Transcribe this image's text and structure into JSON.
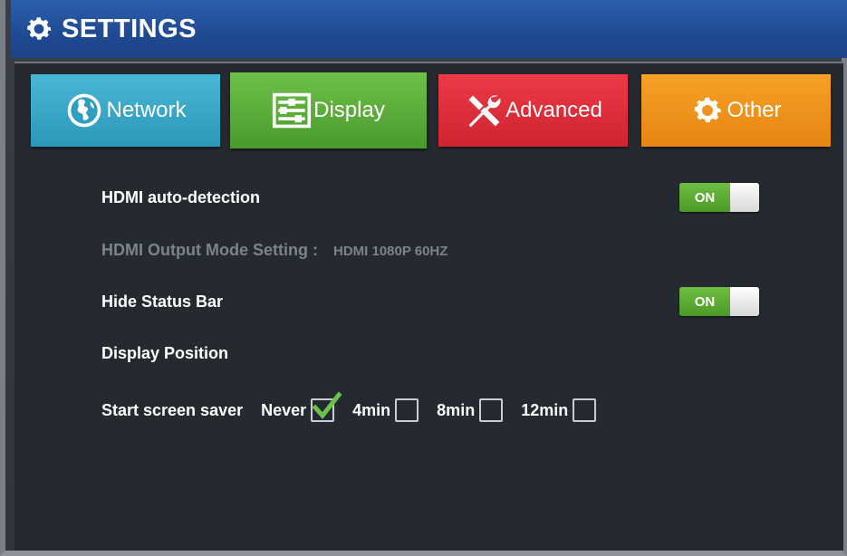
{
  "window": {
    "title": "SETTINGS",
    "title_icon": "gear-icon"
  },
  "tabs": [
    {
      "label": "Network",
      "icon": "globe-icon",
      "color": "#3aa7c8"
    },
    {
      "label": "Display",
      "icon": "sliders-icon",
      "color": "#5cad39",
      "selected": true
    },
    {
      "label": "Advanced",
      "icon": "tools-icon",
      "color": "#de2f3a"
    },
    {
      "label": "Other",
      "icon": "gear-icon",
      "color": "#ef931b"
    }
  ],
  "settings": {
    "hdmi_auto": {
      "label": "HDMI auto-detection",
      "toggle": "ON",
      "state": true
    },
    "hdmi_mode": {
      "label": "HDMI Output Mode Setting :",
      "value": "HDMI 1080P 60HZ",
      "disabled": true
    },
    "hide_status": {
      "label": "Hide Status Bar",
      "toggle": "ON",
      "state": true
    },
    "display_position": {
      "label": "Display Position"
    },
    "screen_saver": {
      "label": "Start screen saver",
      "options": [
        {
          "label": "Never",
          "checked": true
        },
        {
          "label": "4min",
          "checked": false
        },
        {
          "label": "8min",
          "checked": false
        },
        {
          "label": "12min",
          "checked": false
        }
      ]
    }
  },
  "colors": {
    "accent_green": "#5cad39",
    "title_blue": "#2555a0",
    "background": "#252a31"
  }
}
